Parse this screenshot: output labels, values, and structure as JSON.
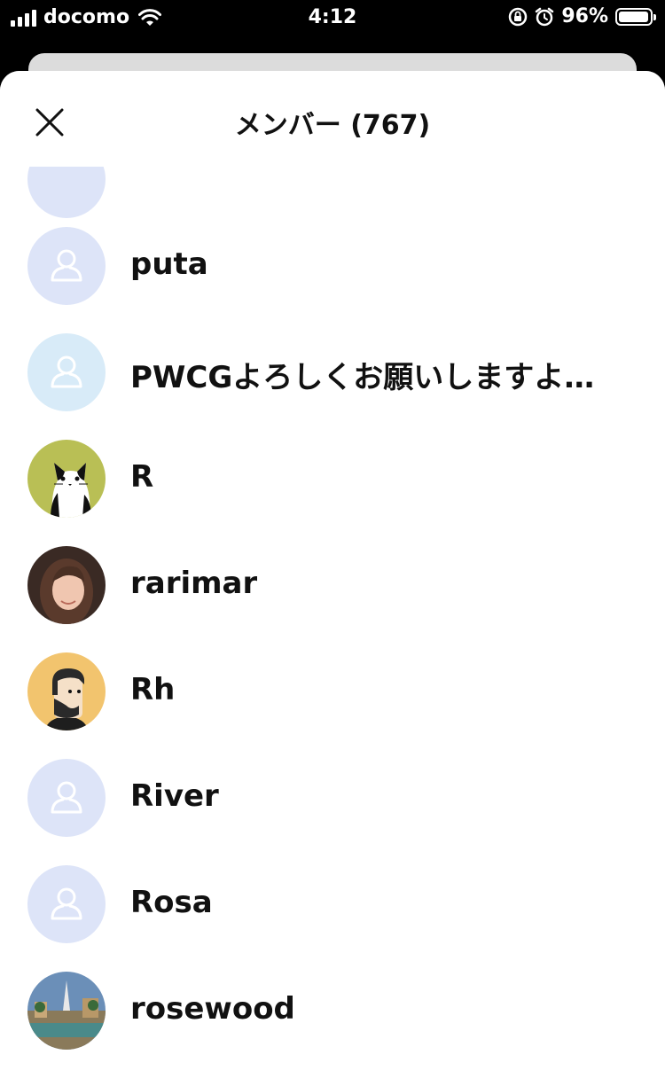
{
  "status_bar": {
    "carrier": "docomo",
    "time": "4:12",
    "battery_percent": "96%",
    "battery_level": 0.96,
    "icons": [
      "cellular-signal-icon",
      "wifi-icon",
      "rotation-lock-icon",
      "alarm-icon",
      "battery-icon"
    ]
  },
  "sheet": {
    "title": "メンバー (767)",
    "close_icon": "close-icon"
  },
  "members": [
    {
      "name": "puta",
      "avatar": "default-person",
      "avatar_bg": "#dde4f8"
    },
    {
      "name": "PWCGよろしくお願いしますよ…",
      "avatar": "default-person",
      "avatar_bg": "#d8ebf8"
    },
    {
      "name": "R",
      "avatar": "cat-illustration",
      "avatar_bg": "#b9bf55"
    },
    {
      "name": "rarimar",
      "avatar": "photo-woman",
      "avatar_bg": "#3a2a24"
    },
    {
      "name": "Rh",
      "avatar": "bearded-man-illustration",
      "avatar_bg": "#f2c46e"
    },
    {
      "name": "River",
      "avatar": "default-person",
      "avatar_bg": "#dde4f8"
    },
    {
      "name": "Rosa",
      "avatar": "default-person",
      "avatar_bg": "#dde4f8"
    },
    {
      "name": "rosewood",
      "avatar": "photo-resort",
      "avatar_bg": "#6b8fb8"
    }
  ]
}
